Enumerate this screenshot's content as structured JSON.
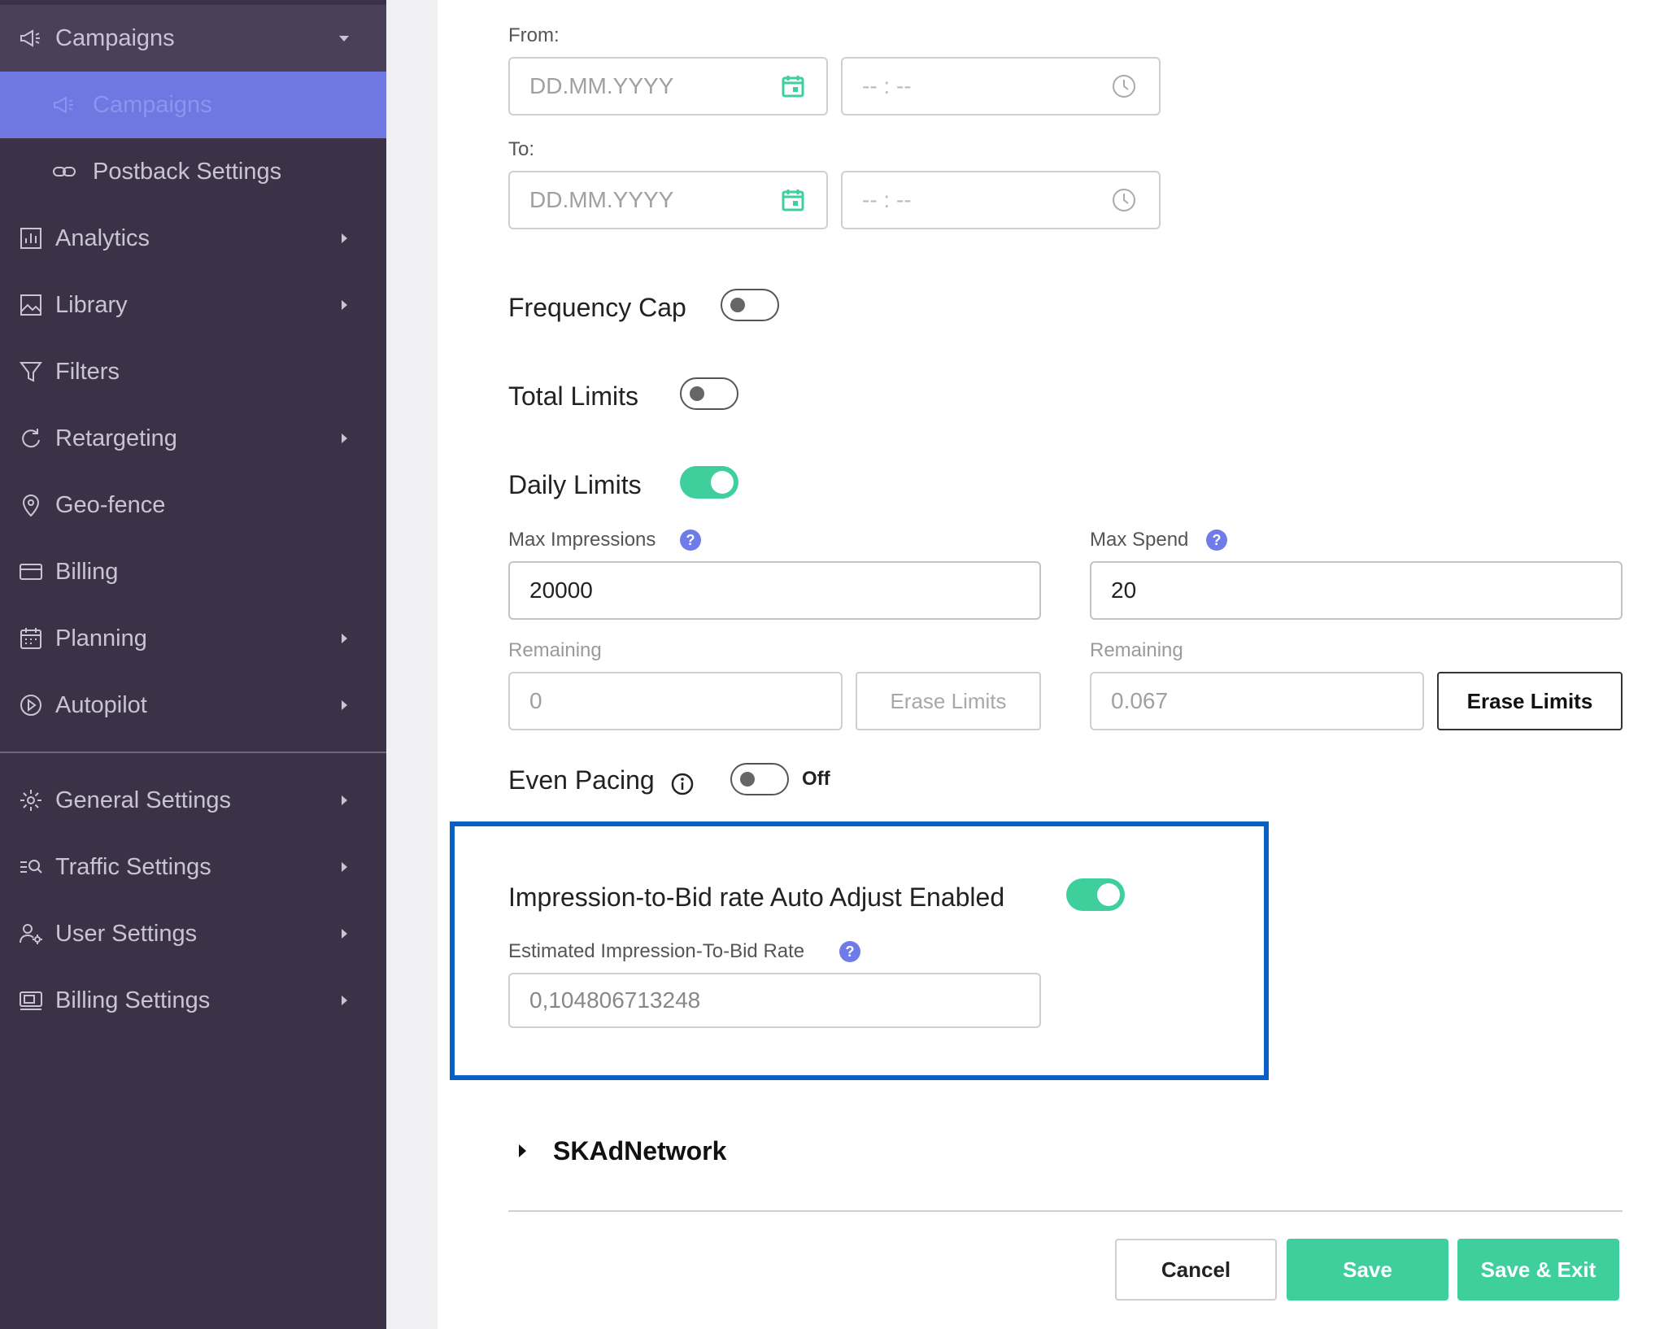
{
  "sidebar": {
    "items": [
      {
        "label": "Campaigns",
        "icon": "megaphone-icon"
      },
      {
        "label": "Campaigns",
        "icon": "megaphone-icon"
      },
      {
        "label": "Postback Settings",
        "icon": "link-icon"
      },
      {
        "label": "Analytics",
        "icon": "analytics-icon"
      },
      {
        "label": "Library",
        "icon": "image-icon"
      },
      {
        "label": "Filters",
        "icon": "filter-icon"
      },
      {
        "label": "Retargeting",
        "icon": "refresh-icon"
      },
      {
        "label": "Geo-fence",
        "icon": "location-pin-icon"
      },
      {
        "label": "Billing",
        "icon": "credit-card-icon"
      },
      {
        "label": "Planning",
        "icon": "calendar-icon"
      },
      {
        "label": "Autopilot",
        "icon": "play-circle-icon"
      },
      {
        "label": "General Settings",
        "icon": "gear-icon"
      },
      {
        "label": "Traffic Settings",
        "icon": "search-list-icon"
      },
      {
        "label": "User Settings",
        "icon": "user-settings-icon"
      },
      {
        "label": "Billing Settings",
        "icon": "billing-settings-icon"
      }
    ]
  },
  "dates": {
    "from_label": "From:",
    "to_label": "To:",
    "date_placeholder": "DD.MM.YYYY",
    "time_placeholder": "--  :  --"
  },
  "toggles": {
    "frequency_cap": "Frequency Cap",
    "total_limits": "Total Limits",
    "daily_limits": "Daily Limits"
  },
  "limits": {
    "max_impressions_label": "Max Impressions",
    "max_impressions_value": "20000",
    "max_spend_label": "Max Spend",
    "max_spend_value": "20",
    "remaining_label": "Remaining",
    "remaining_impressions": "0",
    "remaining_spend": "0.067",
    "erase_label": "Erase Limits"
  },
  "pacing": {
    "label": "Even Pacing",
    "state": "Off"
  },
  "bid_rate": {
    "toggle_label": "Impression-to-Bid rate Auto Adjust Enabled",
    "estimate_label": "Estimated Impression-To-Bid Rate",
    "estimate_value": "0,104806713248"
  },
  "skad": {
    "label": "SKAdNetwork"
  },
  "footer": {
    "cancel": "Cancel",
    "save": "Save",
    "save_exit": "Save & Exit"
  },
  "colors": {
    "sidebar_bg": "#3b3247",
    "active_item": "#6e78e0",
    "accent_green": "#3ecf9c",
    "help_icon": "#6f7be8",
    "highlight_border": "#0b5ec2"
  }
}
